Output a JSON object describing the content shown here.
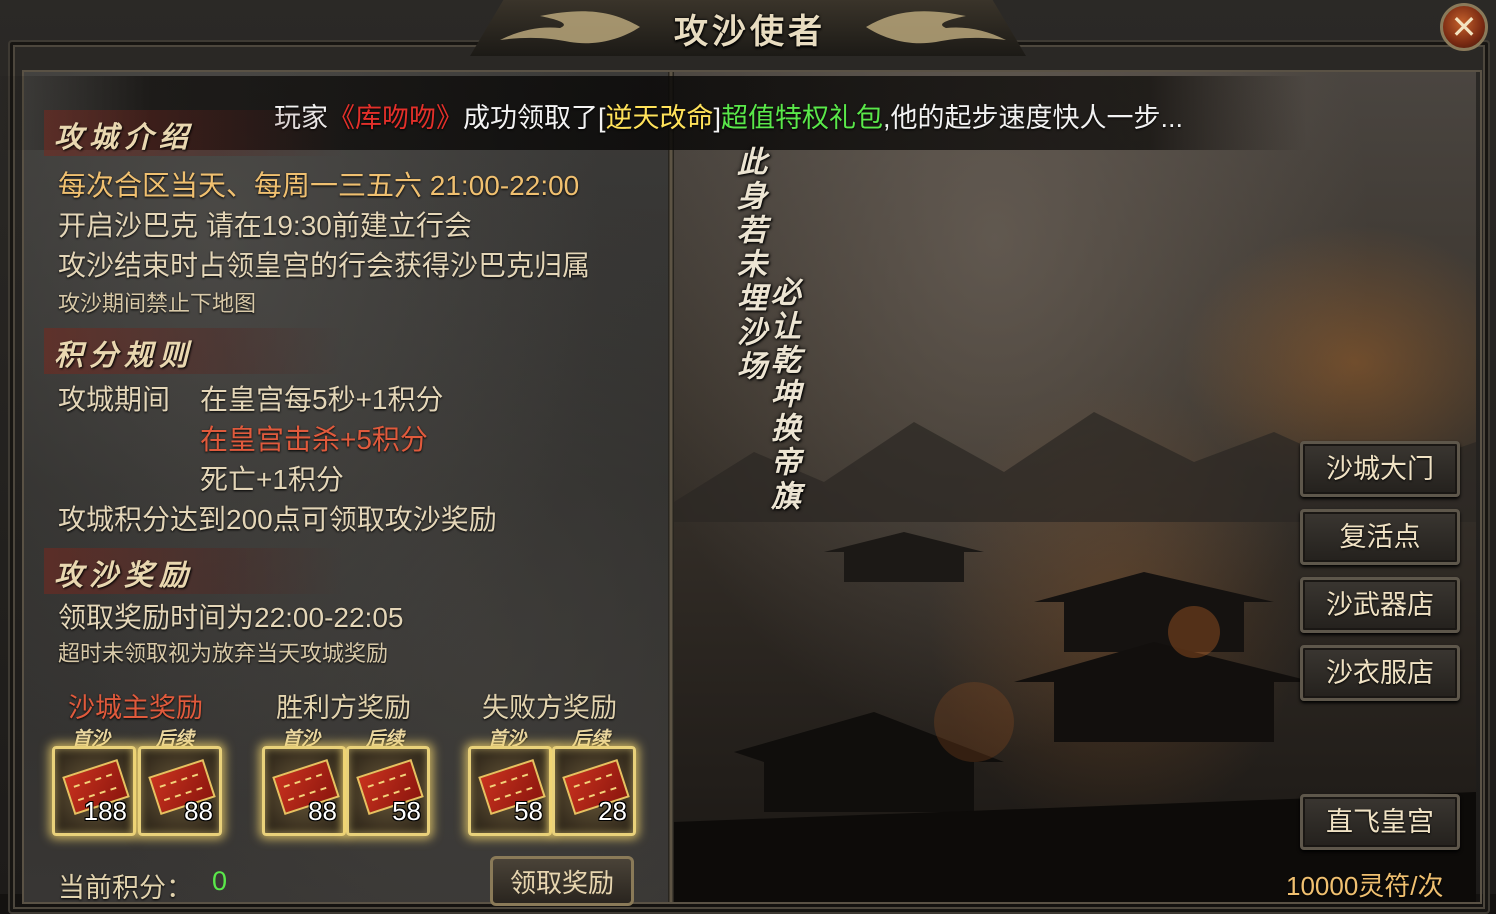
{
  "window": {
    "title": "攻沙使者",
    "close_label": "✕"
  },
  "notice": {
    "prefix": "玩家",
    "player": "《库吻吻》",
    "middle": "成功领取了[",
    "item": "逆天改命",
    "bracket_close": "]",
    "package": "超值特权礼包",
    "suffix": ",他的起步速度快人一步..."
  },
  "intro": {
    "heading": "攻城介绍",
    "lines": [
      "每次合区当天、每周一三五六 21:00-22:00",
      "开启沙巴克   请在19:30前建立行会",
      "攻沙结束时占领皇宫的行会获得沙巴克归属"
    ],
    "note": "攻沙期间禁止下地图"
  },
  "rules": {
    "heading": "积分规则",
    "period_label": "攻城期间",
    "rule1": "在皇宫每5秒+1积分",
    "rule2": "在皇宫击杀+5积分",
    "rule3": "死亡+1积分",
    "threshold": "攻城积分达到200点可领取攻沙奖励"
  },
  "rewards": {
    "heading": "攻沙奖励",
    "time": "领取奖励时间为22:00-22:05",
    "note": "超时未领取视为放弃当天攻城奖励",
    "groups": [
      {
        "title": "沙城主奖励",
        "first_label": "首沙",
        "later_label": "后续",
        "first_count": "188",
        "later_count": "88"
      },
      {
        "title": "胜利方奖励",
        "first_label": "首沙",
        "later_label": "后续",
        "first_count": "88",
        "later_count": "58"
      },
      {
        "title": "失败方奖励",
        "first_label": "首沙",
        "later_label": "后续",
        "first_count": "58",
        "later_count": "28"
      }
    ]
  },
  "points": {
    "label": "当前积分：",
    "value": "0"
  },
  "claim_button": "领取奖励",
  "poem": {
    "col1": "此身若未埋沙场",
    "col2": "必让乾坤换帝旗"
  },
  "teleports": [
    "沙城大门",
    "复活点",
    "沙武器店",
    "沙衣服店"
  ],
  "fly_button": "直飞皇宫",
  "cost": "10000灵符/次",
  "colors": {
    "notice_player": "#e3302a",
    "notice_item": "#ffe25a",
    "notice_package": "#5ae84a",
    "slot_glow": "#f5d76e"
  },
  "icons": {
    "close": "close-icon",
    "reward_item": "ticket-icon",
    "title_ornament": "dragon-ornament-icon"
  }
}
